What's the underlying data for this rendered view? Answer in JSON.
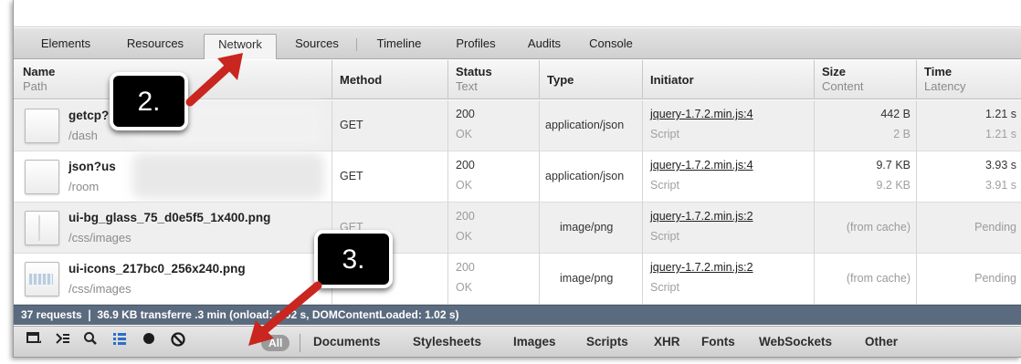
{
  "tabs": [
    "Elements",
    "Resources",
    "Network",
    "Sources",
    "Timeline",
    "Profiles",
    "Audits",
    "Console"
  ],
  "selected_tab": "Network",
  "columns": {
    "name": {
      "primary": "Name",
      "secondary": "Path"
    },
    "method": {
      "primary": "Method"
    },
    "status": {
      "primary": "Status",
      "secondary": "Text"
    },
    "type": {
      "primary": "Type"
    },
    "initiator": {
      "primary": "Initiator"
    },
    "size": {
      "primary": "Size",
      "secondary": "Content"
    },
    "time": {
      "primary": "Time",
      "secondary": "Latency"
    }
  },
  "rows": [
    {
      "name": "getcp?",
      "path": "/dash",
      "method": "GET",
      "status": "200",
      "status_text": "OK",
      "type": "application/json",
      "initiator": "jquery-1.7.2.min.js:4",
      "initiator_type": "Script",
      "size": "442 B",
      "content": "2 B",
      "time": "1.21 s",
      "latency": "1.21 s"
    },
    {
      "name": "json?us",
      "path": "/room",
      "method": "GET",
      "status": "200",
      "status_text": "OK",
      "type": "application/json",
      "initiator": "jquery-1.7.2.min.js:4",
      "initiator_type": "Script",
      "size": "9.7 KB",
      "content": "9.2 KB",
      "time": "3.93 s",
      "latency": "3.91 s"
    },
    {
      "name": "ui-bg_glass_75_d0e5f5_1x400.png",
      "path": "/css/images",
      "method": "GET",
      "status": "200",
      "status_text": "OK",
      "type": "image/png",
      "initiator": "jquery-1.7.2.min.js:2",
      "initiator_type": "Script",
      "size": "(from cache)",
      "time": "Pending"
    },
    {
      "name": "ui-icons_217bc0_256x240.png",
      "path": "/css/images",
      "status": "200",
      "status_text": "OK",
      "type": "image/png",
      "initiator": "jquery-1.7.2.min.js:2",
      "initiator_type": "Script",
      "size": "(from cache)",
      "time": "Pending"
    }
  ],
  "status_summary": "37 requests  ❘  36.9 KB transferre              .3 min (onload: 1.02 s, DOMContentLoaded: 1.02 s)",
  "toolbar_filters": [
    "All",
    "Documents",
    "Stylesheets",
    "Images",
    "Scripts",
    "XHR",
    "Fonts",
    "WebSockets",
    "Other"
  ],
  "annotations": {
    "callout_2": "2.",
    "callout_3": "3."
  },
  "colors": {
    "status_bar": "#5b6b7f",
    "arrow": "#c8261e",
    "callout": "#000000"
  },
  "icons": [
    "dock-icon",
    "console-icon",
    "search-icon",
    "list-view-icon",
    "record-icon",
    "clear-icon"
  ]
}
